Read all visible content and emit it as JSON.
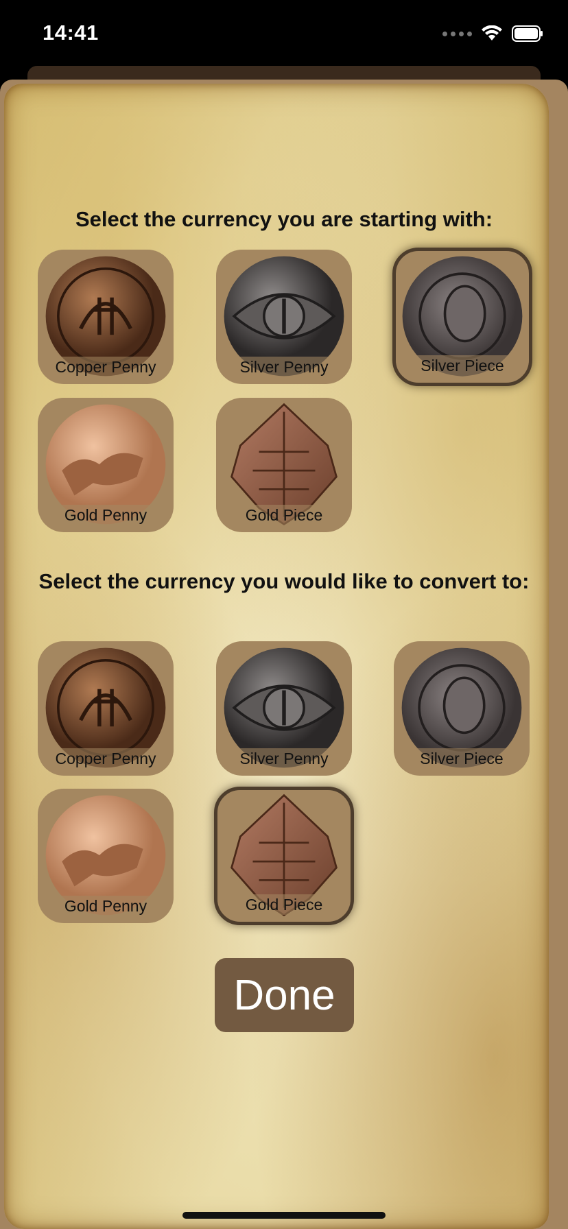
{
  "status_bar": {
    "time": "14:41"
  },
  "sections": {
    "from_heading": "Select the currency you are starting with:",
    "to_heading": "Select the currency you would like to convert to:"
  },
  "coins": {
    "copper_penny": "Copper Penny",
    "silver_penny": "Silver Penny",
    "silver_piece": "Silver Piece",
    "gold_penny": "Gold Penny",
    "gold_piece": "Gold Piece"
  },
  "selection": {
    "from": "Silver Piece",
    "to": "Gold Piece"
  },
  "done_label": "Done",
  "colors": {
    "tile": "#a48760",
    "button": "#735a41",
    "selected_border": "#4d3d2c"
  }
}
